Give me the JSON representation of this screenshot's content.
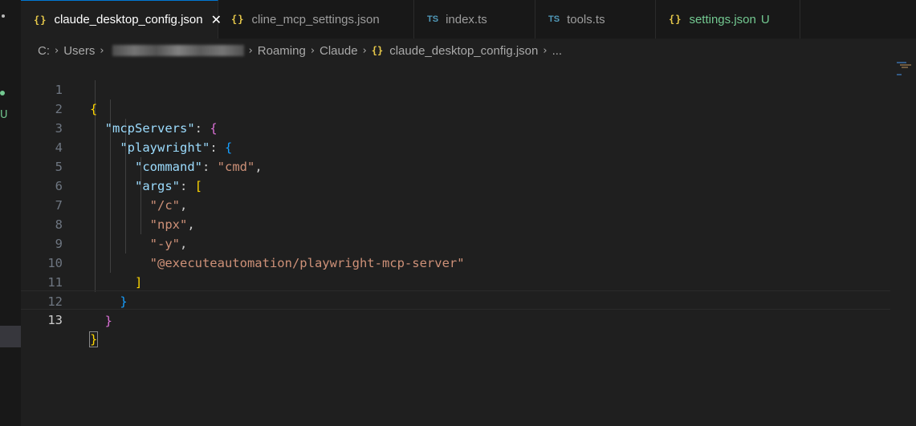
{
  "activity": {
    "u_badge": "U"
  },
  "tabs": [
    {
      "icon": "{}",
      "label": "claude_desktop_config.json",
      "close": "✕"
    },
    {
      "icon": "{}",
      "label": "cline_mcp_settings.json"
    },
    {
      "icon": "TS",
      "label": "index.ts"
    },
    {
      "icon": "TS",
      "label": "tools.ts"
    },
    {
      "icon": "{}",
      "label": "settings.json",
      "badge": "U"
    }
  ],
  "breadcrumb": {
    "drive": "C:",
    "users": "Users",
    "roaming": "Roaming",
    "claude": "Claude",
    "file_icon": "{}",
    "file": "claude_desktop_config.json",
    "more": "...",
    "sep": "›"
  },
  "editor": {
    "line_numbers": [
      "1",
      "2",
      "3",
      "4",
      "5",
      "6",
      "7",
      "8",
      "9",
      "10",
      "11",
      "12",
      "13"
    ],
    "tokens": {
      "brace_open": "{",
      "brace_close": "}",
      "key_mcpServers": "\"mcpServers\"",
      "key_playwright": "\"playwright\"",
      "key_command": "\"command\"",
      "val_cmd": "\"cmd\"",
      "key_args": "\"args\"",
      "bracket_open": "[",
      "bracket_close": "]",
      "arg1": "\"/c\"",
      "arg2": "\"npx\"",
      "arg3": "\"-y\"",
      "arg4": "\"@executeautomation/playwright-mcp-server\"",
      "colon": ": ",
      "comma": ","
    }
  },
  "colors": {
    "key": "#9cdcfe",
    "string": "#ce9178",
    "bracket_level1": "#ffd700",
    "bracket_level2": "#da70d6",
    "bracket_level3": "#179fff",
    "json_icon": "#e6c84a",
    "ts_icon": "#519aba",
    "git_untracked": "#73c991",
    "active_tab_accent": "#0078d4"
  }
}
